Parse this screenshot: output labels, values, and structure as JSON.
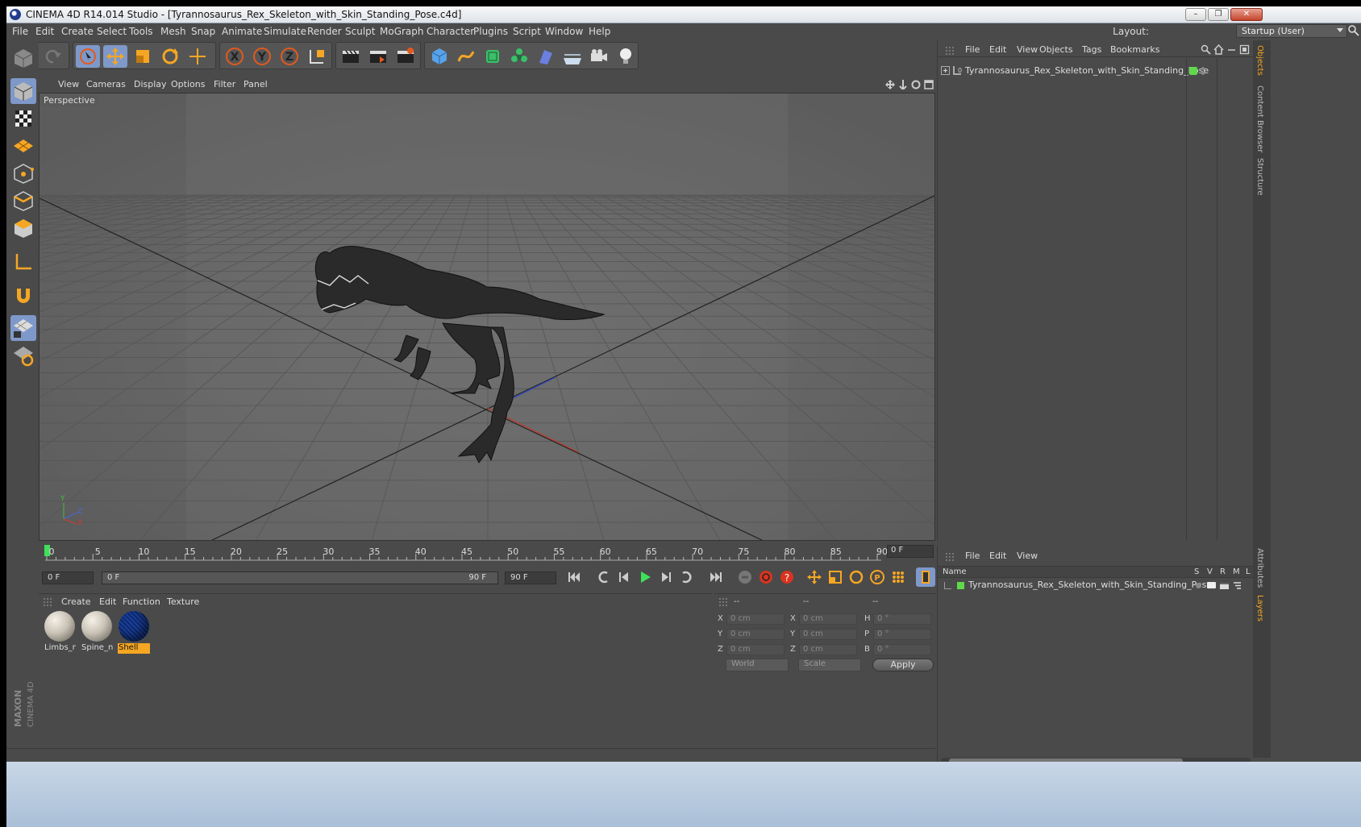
{
  "window": {
    "title": "CINEMA 4D R14.014 Studio - [Tyrannosaurus_Rex_Skeleton_with_Skin_Standing_Pose.c4d]",
    "controls": [
      "–",
      "❐",
      "✕"
    ]
  },
  "menubar": {
    "items": [
      "File",
      "Edit",
      "Create",
      "Select",
      "Tools",
      "Mesh",
      "Snap",
      "Animate",
      "Simulate",
      "Render",
      "Sculpt",
      "MoGraph",
      "Character",
      "Plugins",
      "Script",
      "Window",
      "Help"
    ],
    "layout_label": "Layout:",
    "layout_value": "Startup (User)"
  },
  "viewport": {
    "menu": [
      "View",
      "Cameras",
      "Display",
      "Options",
      "Filter",
      "Panel"
    ],
    "label": "Perspective",
    "axis_labels": [
      "Y",
      "Z",
      "X"
    ]
  },
  "timeline": {
    "ticks": [
      "0",
      "5",
      "10",
      "15",
      "20",
      "25",
      "30",
      "35",
      "40",
      "45",
      "50",
      "55",
      "60",
      "65",
      "70",
      "75",
      "80",
      "85",
      "90"
    ],
    "current_frame": "0 F"
  },
  "transport": {
    "start_field": "0 F",
    "range_start": "0 F",
    "range_end": "90 F",
    "end_field": "90 F"
  },
  "material_manager": {
    "menu": [
      "Create",
      "Edit",
      "Function",
      "Texture"
    ],
    "materials": [
      {
        "name": "Limbs_n",
        "color": "#c9c3b6",
        "selected": false
      },
      {
        "name": "Spine_n",
        "color": "#c9c3b6",
        "selected": false
      },
      {
        "name": "Shell",
        "color": "#0e2a6e",
        "selected": true
      }
    ]
  },
  "coordinates": {
    "headers": [
      "--",
      "--",
      "--"
    ],
    "rows": [
      {
        "a": "X",
        "av": "0 cm",
        "b": "X",
        "bv": "0 cm",
        "c": "H",
        "cv": "0 °"
      },
      {
        "a": "Y",
        "av": "0 cm",
        "b": "Y",
        "bv": "0 cm",
        "c": "P",
        "cv": "0 °"
      },
      {
        "a": "Z",
        "av": "0 cm",
        "b": "Z",
        "bv": "0 cm",
        "c": "B",
        "cv": "0 °"
      }
    ],
    "space": "World",
    "mode": "Scale",
    "apply": "Apply"
  },
  "object_manager": {
    "menu": [
      "File",
      "Edit",
      "View",
      "Objects",
      "Tags",
      "Bookmarks"
    ],
    "object": "Tyrannosaurus_Rex_Skeleton_with_Skin_Standing_Pose"
  },
  "layer_manager": {
    "menu": [
      "File",
      "Edit",
      "View"
    ],
    "columns": {
      "name": "Name",
      "s": "S",
      "v": "V",
      "r": "R",
      "m": "M",
      "l": "L"
    },
    "layer": "Tyrannosaurus_Rex_Skeleton_with_Skin_Standing_Pose"
  },
  "right_tabs": [
    "Objects",
    "Content Browser",
    "Structure",
    "Attributes",
    "Layers"
  ],
  "brand": {
    "maxon": "MAXON",
    "c4d": "CINEMA 4D"
  },
  "colors": {
    "accent": "#7e99c9",
    "selected": "#f5a623",
    "layer_green": "#5fd94a"
  }
}
